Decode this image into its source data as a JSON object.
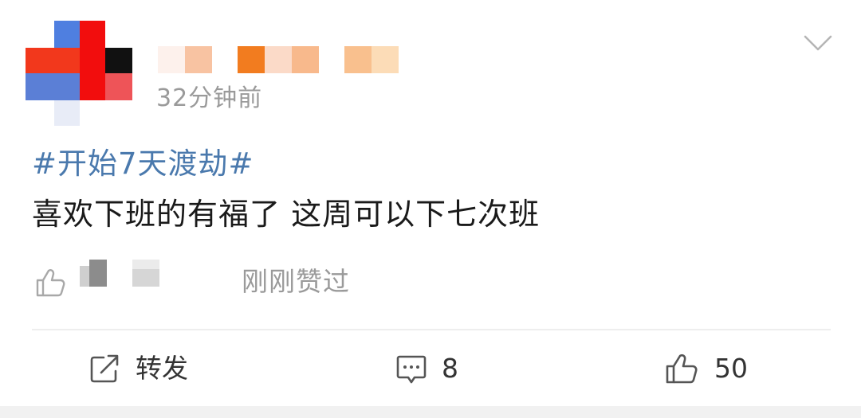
{
  "post": {
    "time": "32分钟前",
    "hashtag": "#开始7天渡劫#",
    "content": "喜欢下班的有福了 这周可以下七次班",
    "liked_status": "刚刚赞过"
  },
  "actions": {
    "repost_label": "转发",
    "comment_count": "8",
    "like_count": "50"
  },
  "colors": {
    "hashtag": "#4a79ad",
    "secondary_text": "#9a9a9a",
    "primary_text": "#1a1a1a"
  },
  "icons": {
    "more": "chevron-down-icon",
    "like": "thumbs-up-icon",
    "repost": "share-icon",
    "comment": "comment-icon"
  }
}
